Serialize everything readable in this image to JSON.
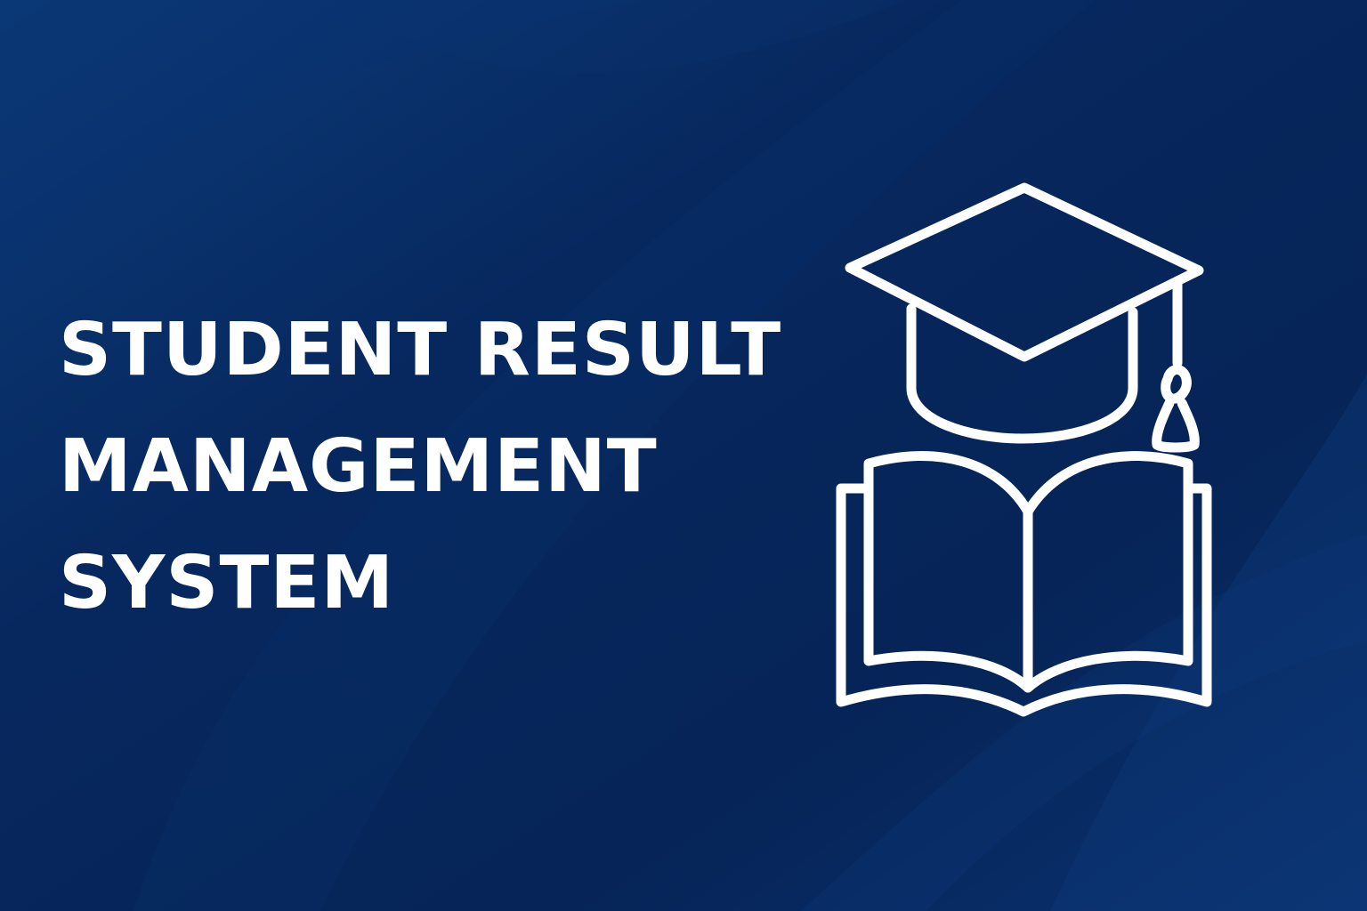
{
  "title": {
    "line1": "STUDENT RESULT",
    "line2": "MANAGEMENT",
    "line3": "SYSTEM"
  },
  "colors": {
    "background_dark": "#06255a",
    "background_light": "#0b3a79",
    "foreground": "#ffffff"
  },
  "icons": [
    "graduation-cap-icon",
    "open-book-icon"
  ]
}
